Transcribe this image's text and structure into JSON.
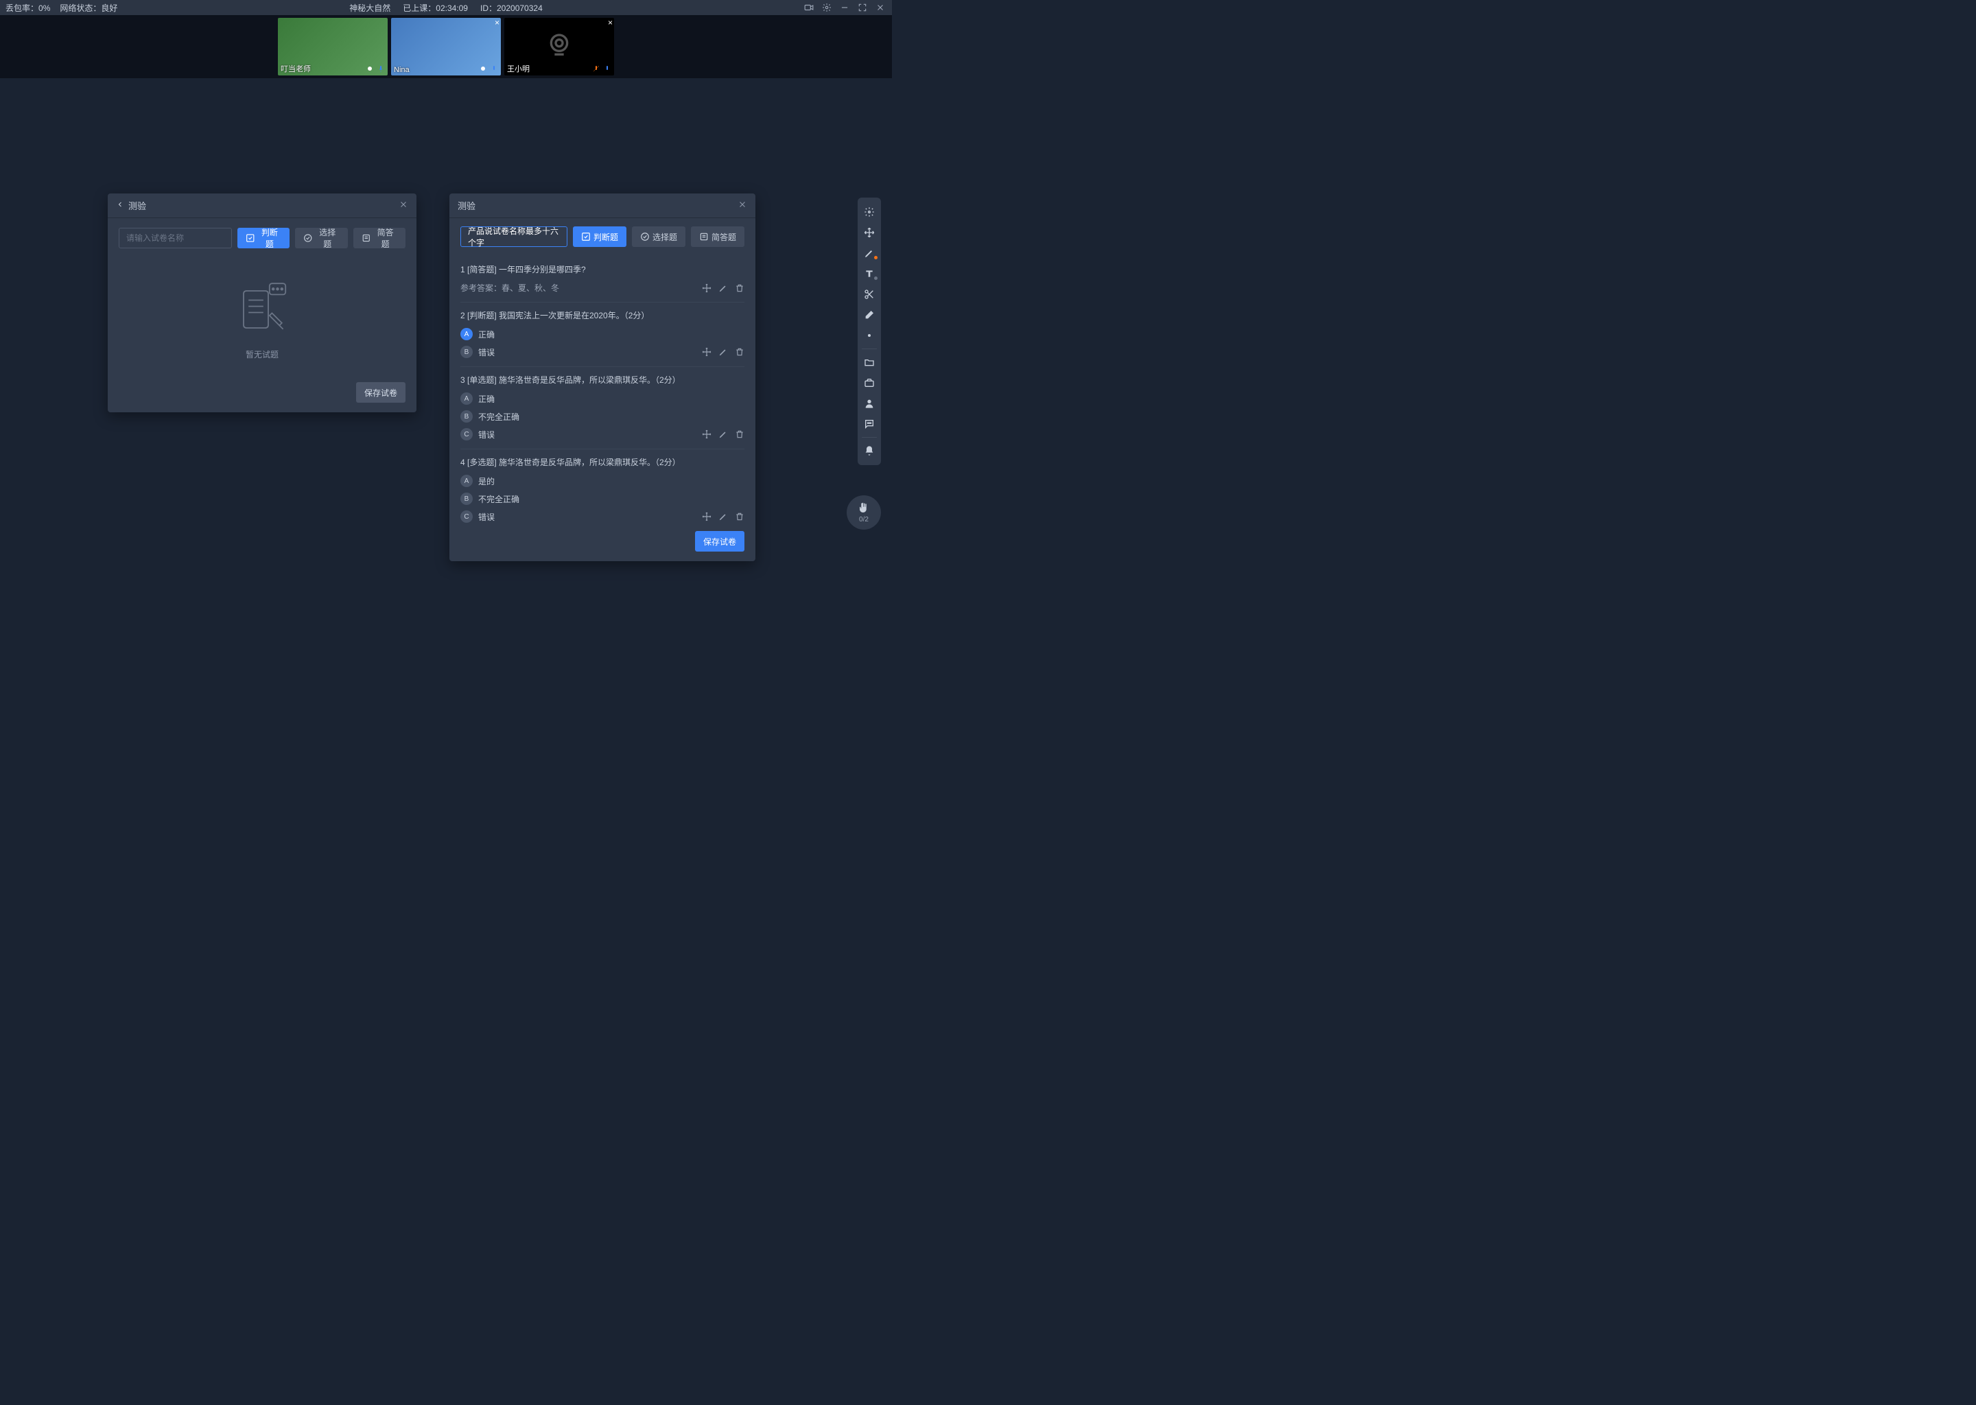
{
  "status": {
    "packet_loss_label": "丢包率：",
    "packet_loss_value": "0%",
    "network_label": "网络状态：",
    "network_value": "良好",
    "course_title": "神秘大自然",
    "duration_label": "已上课：",
    "duration_value": "02:34:09",
    "id_label": "ID：",
    "id_value": "2020070324"
  },
  "participants": [
    {
      "name": "叮当老师",
      "camera": true,
      "mic_muted": false,
      "tile_style": "teacher"
    },
    {
      "name": "Nina",
      "camera": true,
      "mic_muted": false,
      "tile_style": "nina"
    },
    {
      "name": "王小明",
      "camera": false,
      "mic_muted": true,
      "tile_style": "off"
    }
  ],
  "panel_left": {
    "title": "测验",
    "input_placeholder": "请输入试卷名称",
    "btn_tf": "判断题",
    "btn_choice": "选择题",
    "btn_short": "简答题",
    "empty_caption": "暂无试题",
    "save_btn": "保存试卷"
  },
  "panel_right": {
    "title": "测验",
    "exam_name": "产品说试卷名称最多十六个字",
    "btn_tf": "判断题",
    "btn_choice": "选择题",
    "btn_short": "简答题",
    "save_btn": "保存试卷",
    "answer_prefix": "参考答案：",
    "questions": [
      {
        "index": "1",
        "type_label": "[简答题]",
        "text": "一年四季分别是哪四季?",
        "answer": "春、夏、秋、冬",
        "options": []
      },
      {
        "index": "2",
        "type_label": "[判断题]",
        "text": "我国宪法上一次更新是在2020年。（2分）",
        "options": [
          {
            "key": "A",
            "text": "正确",
            "correct": true
          },
          {
            "key": "B",
            "text": "错误",
            "correct": false
          }
        ]
      },
      {
        "index": "3",
        "type_label": "[单选题]",
        "text": "施华洛世奇是反华品牌，所以梁鼎琪反华。（2分）",
        "options": [
          {
            "key": "A",
            "text": "正确",
            "correct": false
          },
          {
            "key": "B",
            "text": "不完全正确",
            "correct": false
          },
          {
            "key": "C",
            "text": "错误",
            "correct": false
          }
        ]
      },
      {
        "index": "4",
        "type_label": "[多选题]",
        "text": "施华洛世奇是反华品牌，所以梁鼎琪反华。（2分）",
        "options": [
          {
            "key": "A",
            "text": "是的",
            "correct": false
          },
          {
            "key": "B",
            "text": "不完全正确",
            "correct": false
          },
          {
            "key": "C",
            "text": "错误",
            "correct": false
          }
        ]
      }
    ]
  },
  "hand": {
    "count": "0/2"
  }
}
